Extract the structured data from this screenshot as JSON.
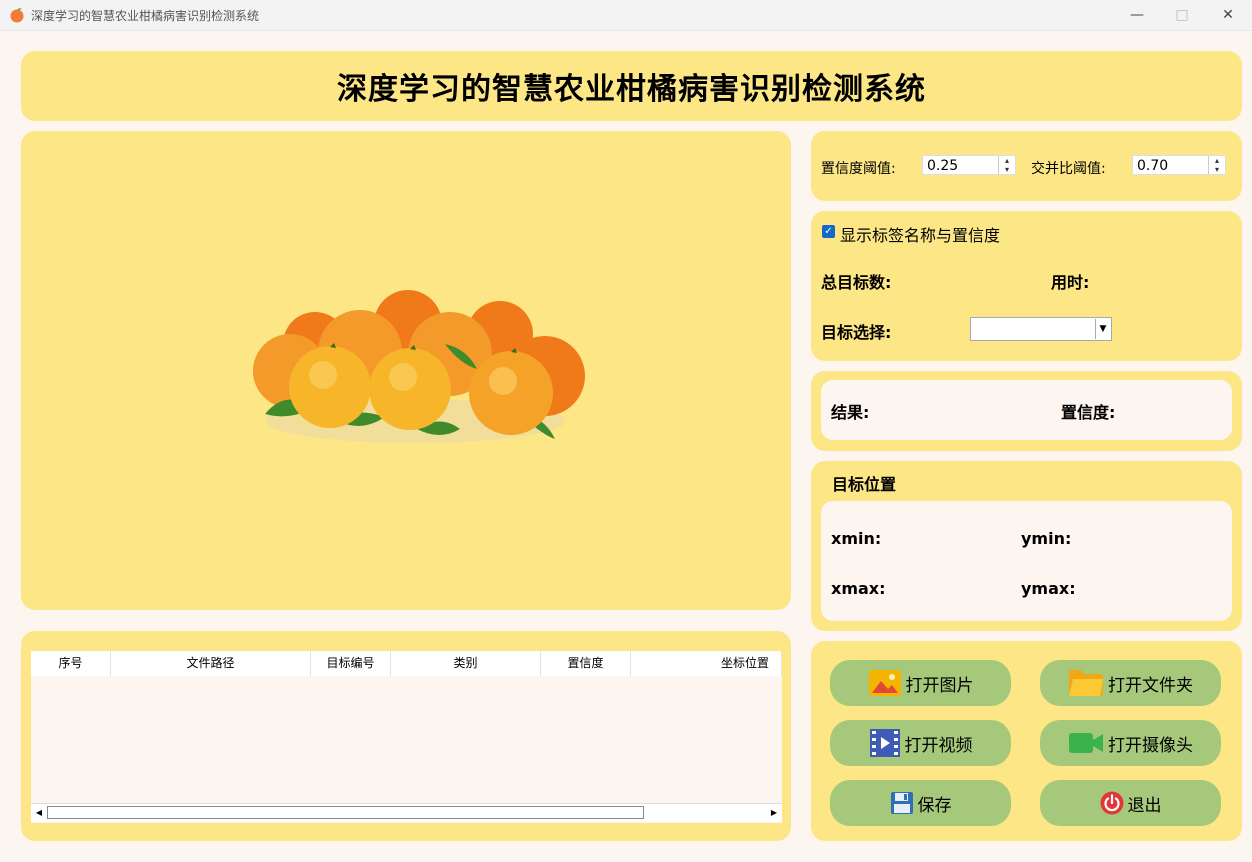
{
  "window": {
    "title": "深度学习的智慧农业柑橘病害识别检测系统"
  },
  "header": {
    "title": "深度学习的智慧农业柑橘病害识别检测系统"
  },
  "params": {
    "conf_label": "置信度阈值:",
    "conf_value": "0.25",
    "iou_label": "交并比阈值:",
    "iou_value": "0.70"
  },
  "info": {
    "show_label_checkbox": "显示标签名称与置信度",
    "show_label_checked": true,
    "total_targets_label": "总目标数:",
    "time_label": "用时:",
    "target_select_label": "目标选择:",
    "target_select_value": ""
  },
  "result": {
    "result_label": "结果:",
    "confidence_label": "置信度:"
  },
  "position": {
    "title": "目标位置",
    "xmin_label": "xmin:",
    "ymin_label": "ymin:",
    "xmax_label": "xmax:",
    "ymax_label": "ymax:"
  },
  "table": {
    "columns": [
      "序号",
      "文件路径",
      "目标编号",
      "类别",
      "置信度",
      "坐标位置"
    ],
    "rows": []
  },
  "buttons": {
    "open_image": "打开图片",
    "open_folder": "打开文件夹",
    "open_video": "打开视频",
    "open_camera": "打开摄像头",
    "save": "保存",
    "exit": "退出"
  },
  "colors": {
    "panel": "#fde686",
    "button": "#a5c87a",
    "background": "#fdf5f0"
  }
}
